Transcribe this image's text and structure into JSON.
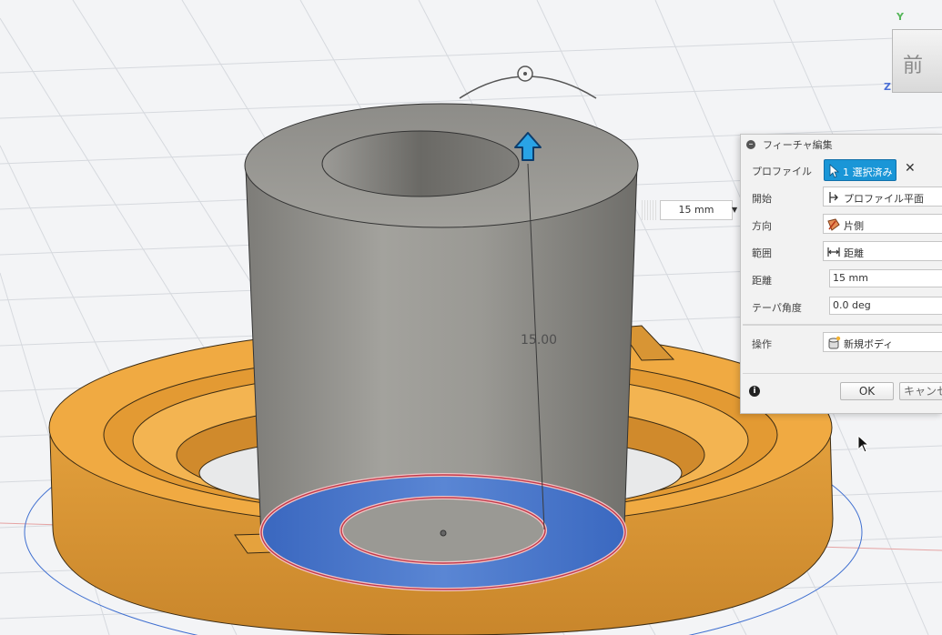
{
  "viewcube": {
    "face_label": "前",
    "axis_y": "Y",
    "axis_z": "Z"
  },
  "canvas": {
    "distance_input_value": "15 mm",
    "dimension_label": "15.00"
  },
  "panel": {
    "title": "フィーチャ編集",
    "rows": {
      "profile": {
        "label": "プロファイル",
        "value": "1 選択済み",
        "clear_glyph": "✕"
      },
      "start": {
        "label": "開始",
        "value": "プロファイル平面"
      },
      "direction": {
        "label": "方向",
        "value": "片側"
      },
      "extent": {
        "label": "範囲",
        "value": "距離"
      },
      "distance": {
        "label": "距離",
        "value": "15 mm"
      },
      "taper": {
        "label": "テーパ角度",
        "value": "0.0 deg"
      },
      "operation": {
        "label": "操作",
        "value": "新規ボディ"
      }
    },
    "info_glyph": "i",
    "ok_label": "OK",
    "cancel_label": "キャンセル"
  },
  "colors": {
    "profile_blue": "#1a96d7",
    "body_orange": "#e8a33c",
    "cylinder_gray": "#8f8e89",
    "selection_blue": "#3f6fc4",
    "grid": "#cfd3d8"
  }
}
